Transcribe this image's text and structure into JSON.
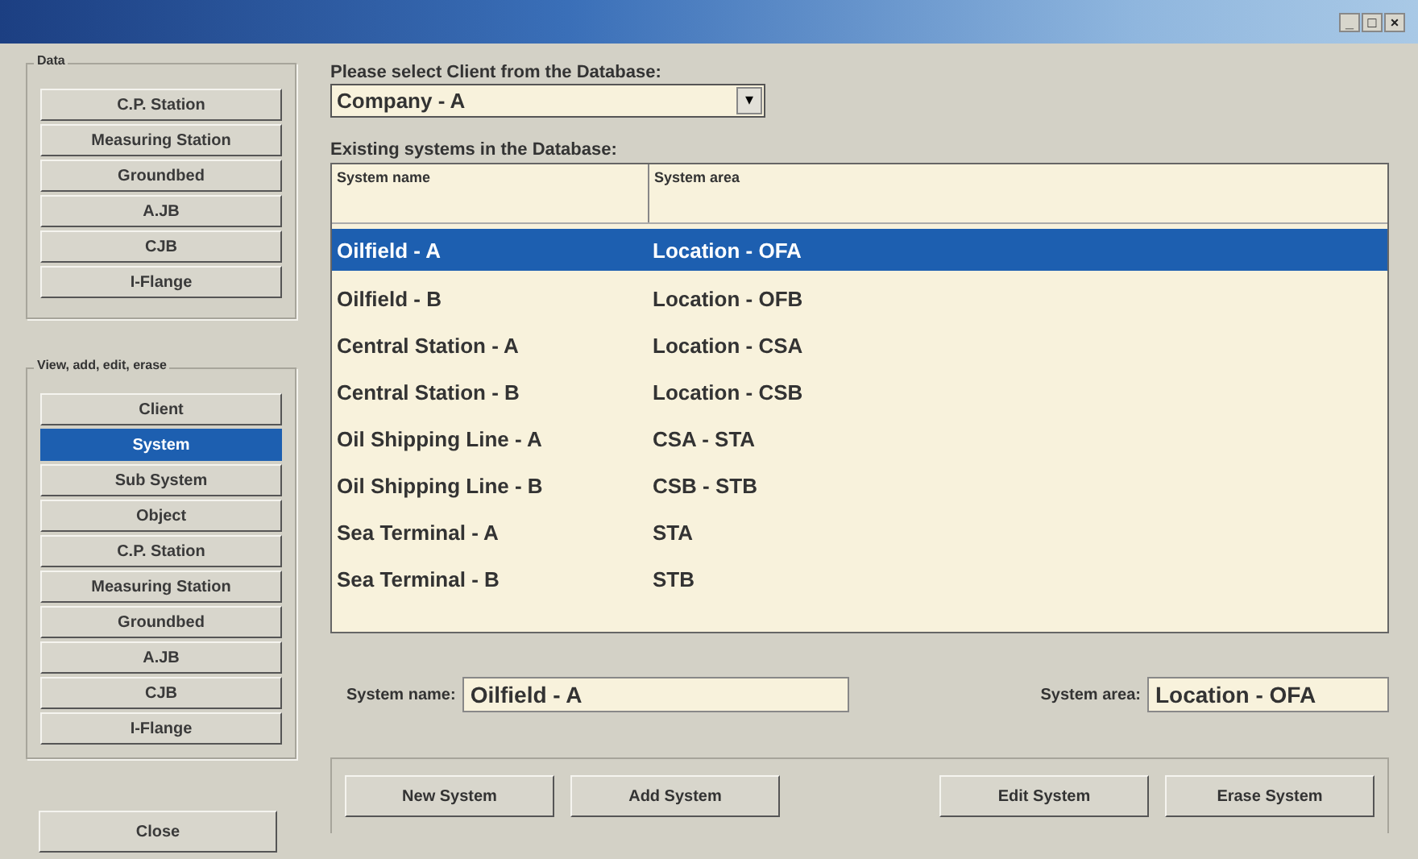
{
  "window": {
    "buttons": [
      "_",
      "□",
      "×"
    ]
  },
  "data_group": {
    "title": "Data",
    "buttons": [
      "C.P. Station",
      "Measuring Station",
      "Groundbed",
      "A.JB",
      "CJB",
      "I-Flange"
    ]
  },
  "view_group": {
    "title": "View, add, edit, erase",
    "items": [
      {
        "label": "Client",
        "selected": false
      },
      {
        "label": "System",
        "selected": true
      },
      {
        "label": "Sub System",
        "selected": false
      },
      {
        "label": "Object",
        "selected": false
      },
      {
        "label": "C.P. Station",
        "selected": false
      },
      {
        "label": "Measuring Station",
        "selected": false
      },
      {
        "label": "Groundbed",
        "selected": false
      },
      {
        "label": "A.JB",
        "selected": false
      },
      {
        "label": "CJB",
        "selected": false
      },
      {
        "label": "I-Flange",
        "selected": false
      }
    ]
  },
  "close_button": "Close",
  "client": {
    "label": "Please select Client from the Database:",
    "value": "Company - A",
    "arrow": "▾"
  },
  "systems": {
    "label": "Existing systems in the Database:",
    "columns": [
      "System name",
      "System area"
    ],
    "rows": [
      {
        "name": "Oilfield - A",
        "area": "Location - OFA",
        "selected": true
      },
      {
        "name": "Oilfield - B",
        "area": "Location - OFB",
        "selected": false
      },
      {
        "name": "Central Station - A",
        "area": "Location - CSA",
        "selected": false
      },
      {
        "name": "Central Station - B",
        "area": "Location - CSB",
        "selected": false
      },
      {
        "name": "Oil Shipping Line - A",
        "area": "CSA - STA",
        "selected": false
      },
      {
        "name": "Oil Shipping Line - B",
        "area": "CSB - STB",
        "selected": false
      },
      {
        "name": "Sea Terminal - A",
        "area": "STA",
        "selected": false
      },
      {
        "name": "Sea Terminal - B",
        "area": "STB",
        "selected": false
      }
    ]
  },
  "fields": [
    {
      "label": "System name:",
      "value": "Oilfield - A"
    },
    {
      "label": "System area:",
      "value": "Location - OFA"
    }
  ],
  "actions": [
    "New System",
    "Add System",
    "Edit System",
    "Erase System"
  ]
}
